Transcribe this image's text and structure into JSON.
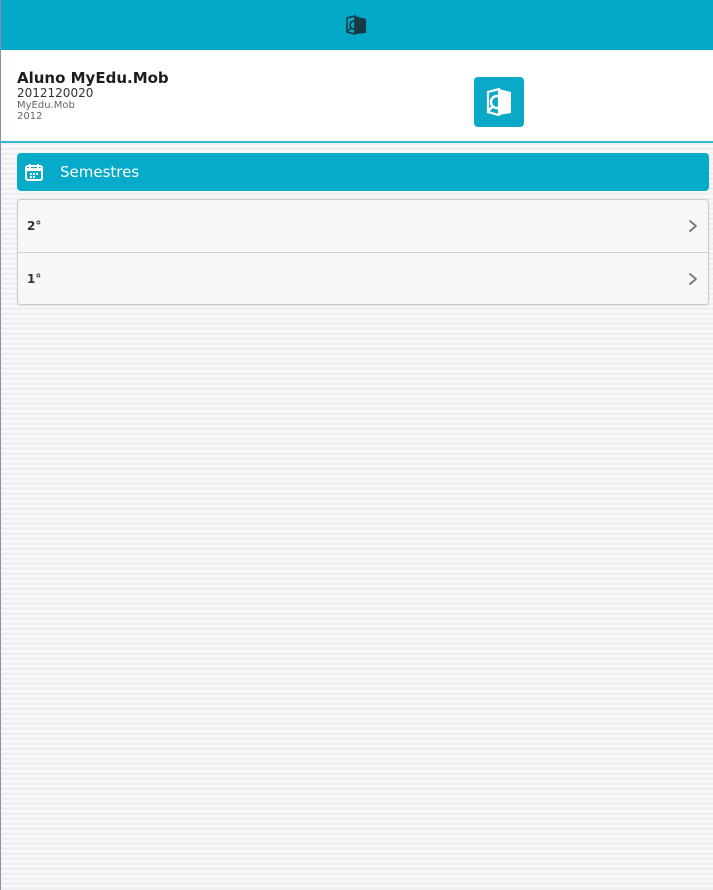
{
  "top_bar": {
    "logo_icon": "search-document-icon",
    "color": "#04a9c7"
  },
  "profile": {
    "name": "Aluno MyEdu.Mob",
    "student_id": "2012120020",
    "institution": "MyEdu.Mob",
    "year": "2012",
    "logo_icon": "search-document-icon"
  },
  "semesters": {
    "title": "Semestres",
    "icon": "calendar-icon",
    "items": [
      {
        "label": "2°",
        "icon": "chevron-right-icon"
      },
      {
        "label": "1°",
        "icon": "chevron-right-icon"
      }
    ]
  },
  "colors": {
    "accent": "#06abc9",
    "background": "#f2f2f2"
  }
}
